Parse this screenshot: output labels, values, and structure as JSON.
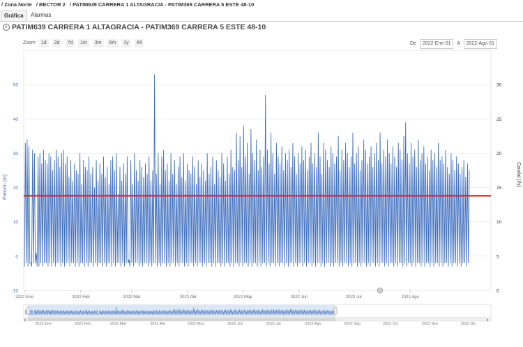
{
  "breadcrumb": {
    "item1": "/ Zona Norte",
    "item2": "/ BECTOR 2",
    "item3": "/ PATIM639 CARRERA 1 ALTAGRACIA - PATIM369 CARRERA 5 ESTE 48-10"
  },
  "tabs": [
    {
      "label": "Gráfica"
    },
    {
      "label": "Alarmas"
    }
  ],
  "page": {
    "title": "PATIM639 CARRERA 1 ALTAGRACIA - PATIM369 CARRERA 5 ESTE 48-10"
  },
  "zoom": {
    "label": "Zoom",
    "buttons": [
      "1d",
      "2d",
      "7d",
      "1m",
      "3m",
      "6m",
      "1y",
      "All"
    ]
  },
  "range": {
    "from_label": "De",
    "from_value": "2022-Ene-01",
    "to_label": "A",
    "to_value": "2022-Ago-31"
  },
  "chart_data": {
    "type": "line",
    "ylabel": "Presión (m)",
    "ylabel2": "Caudal (l/s)",
    "ylim": [
      -10,
      60
    ],
    "y_ticks": [
      "-10",
      "0",
      "10",
      "20",
      "30",
      "40",
      "50"
    ],
    "ylim2": [
      0,
      35
    ],
    "y2_ticks": [
      "0",
      "5",
      "10",
      "15",
      "20",
      "25",
      "30"
    ],
    "x_tick_labels": [
      "2022 Ene",
      "2022 Feb",
      "2022 Mar",
      "2022 Abr",
      "2022 May",
      "2022 Jun",
      "2022 Jul",
      "2022 Ago"
    ],
    "navigator_tick_labels": [
      "2022 Ene",
      "2022 Feb",
      "2022 Mar",
      "2022 Abr",
      "2022 May",
      "2022 Jun",
      "2022 Jul",
      "2022 Ago",
      "2022 Sep",
      "2022 Oct",
      "2022 Nov",
      "2022 Dic"
    ],
    "series": [
      {
        "color": "#3f6fbf",
        "daily_peak_pressure_m": [
          33,
          34,
          32,
          -2,
          31,
          30,
          1,
          29,
          30,
          27,
          31,
          28,
          27,
          30,
          29,
          25,
          28,
          31,
          29,
          26,
          30,
          31,
          27,
          29,
          23,
          28,
          22,
          27,
          25,
          24,
          30,
          21,
          28,
          26,
          25,
          29,
          24,
          26,
          20,
          28,
          22,
          27,
          24,
          29,
          23,
          26,
          21,
          28,
          29,
          25,
          30,
          18,
          26,
          22,
          27,
          24,
          29,
          -1,
          28,
          21,
          30,
          25,
          22,
          28,
          26,
          23,
          27,
          24,
          29,
          22,
          25,
          53,
          24,
          30,
          21,
          29,
          31,
          25,
          27,
          22,
          30,
          24,
          28,
          21,
          26,
          29,
          23,
          30,
          22,
          27,
          25,
          24,
          29,
          26,
          21,
          28,
          23,
          27,
          25,
          22,
          30,
          24,
          26,
          29,
          21,
          28,
          25,
          23,
          30,
          27,
          22,
          29,
          24,
          31,
          26,
          25,
          36,
          28,
          35,
          26,
          38,
          29,
          33,
          24,
          37,
          30,
          28,
          34,
          25,
          31,
          26,
          29,
          47,
          31,
          27,
          36,
          30,
          24,
          33,
          29,
          27,
          32,
          25,
          30,
          28,
          31,
          26,
          33,
          29,
          24,
          30,
          27,
          32,
          28,
          31,
          25,
          29,
          33,
          27,
          30,
          26,
          36,
          29,
          24,
          33,
          31,
          28,
          26,
          32,
          30,
          27,
          29,
          35,
          25,
          31,
          28,
          33,
          30,
          26,
          29,
          36,
          27,
          30,
          32,
          25,
          28,
          34,
          31,
          27,
          29,
          32,
          26,
          30,
          33,
          28,
          36,
          27,
          31,
          29,
          34,
          30,
          27,
          32,
          29,
          26,
          33,
          31,
          28,
          35,
          39,
          30,
          27,
          33,
          29,
          31,
          26,
          34,
          28,
          30,
          32,
          27,
          29,
          25,
          31,
          28,
          30,
          26,
          33,
          28,
          29,
          27,
          31,
          26,
          24,
          30,
          28,
          25,
          29,
          27,
          24,
          26,
          28,
          23,
          27,
          25,
          26,
          24,
          22,
          27,
          25,
          23,
          26,
          24,
          22,
          27,
          25
        ],
        "daily_min_pressure_m": [
          -3,
          -2,
          -3,
          -2,
          -3,
          -2,
          -2,
          -3,
          -3,
          -2,
          -3,
          -2,
          -2,
          -3,
          -2,
          -3,
          -2,
          -3,
          -2,
          -2,
          -3,
          -2,
          -3,
          -2,
          -2,
          -3,
          -2,
          -2,
          -3,
          -2,
          -3,
          -2,
          -2,
          -3,
          -2,
          -3,
          -2,
          -2,
          -3,
          -2,
          -3,
          -2,
          -2,
          -3,
          -2,
          -3,
          -2,
          -2,
          -3,
          -2,
          -3,
          -2,
          -2,
          -3,
          -2,
          -3,
          -2,
          -2,
          -3,
          -2,
          -3,
          -2,
          -2,
          -3,
          -2,
          -3,
          -2,
          -2,
          -3,
          -2,
          -3,
          -2,
          -2,
          -3,
          -2,
          -3,
          -2,
          -2,
          -3,
          -2,
          -3,
          -2,
          -2,
          -3,
          -2,
          -3,
          -2,
          -2,
          -3,
          -2,
          -3,
          -2,
          -2,
          -3,
          -2,
          -3,
          -2,
          -2,
          -3,
          -2,
          -3,
          -2,
          -2,
          -3,
          -2,
          -3,
          -2,
          -2,
          -3,
          -2,
          -3,
          -2,
          -2,
          -3,
          -2,
          -3,
          -2,
          -2,
          -3,
          -2,
          -3,
          -2,
          -2,
          -3,
          -2,
          -3,
          -2,
          -2,
          -3,
          -2,
          -3,
          -2,
          -2,
          -3,
          -2,
          -3,
          -2,
          -2,
          -3,
          -2,
          -3,
          -2,
          -2,
          -3,
          -2,
          -3,
          -2,
          -2,
          -3,
          -2,
          -3,
          -2,
          -2,
          -3,
          -2,
          -3,
          -2,
          -2,
          -3,
          -2,
          -3,
          -2,
          -2,
          -3,
          -2,
          -3,
          -2,
          -2,
          -3,
          -2,
          -3,
          -2,
          -2,
          -3,
          -2,
          -3,
          -2,
          -2,
          -3,
          -2,
          -3,
          -2,
          -2,
          -3,
          -2,
          -3,
          -2,
          -2,
          -3,
          -2,
          -3,
          -2,
          -2,
          -3,
          -2,
          -3,
          -2,
          -2,
          -3,
          -2,
          -3,
          -2,
          -2,
          -3,
          -2,
          -3,
          -2,
          -2,
          -3,
          -2,
          -3,
          -2,
          -2,
          -3,
          -2,
          -3,
          -2,
          -2,
          -3,
          -2,
          -3,
          -2,
          -2,
          -3,
          -2,
          -3,
          -2,
          -2,
          -3,
          -2,
          -3,
          -2,
          -2,
          -3,
          -2,
          -3,
          -2,
          -2,
          -3,
          -2,
          -3,
          -2,
          -2,
          -3,
          -2
        ]
      },
      {
        "color": "#d9262c",
        "axis": "right",
        "value_lps": 13.8
      }
    ],
    "grid": true
  }
}
